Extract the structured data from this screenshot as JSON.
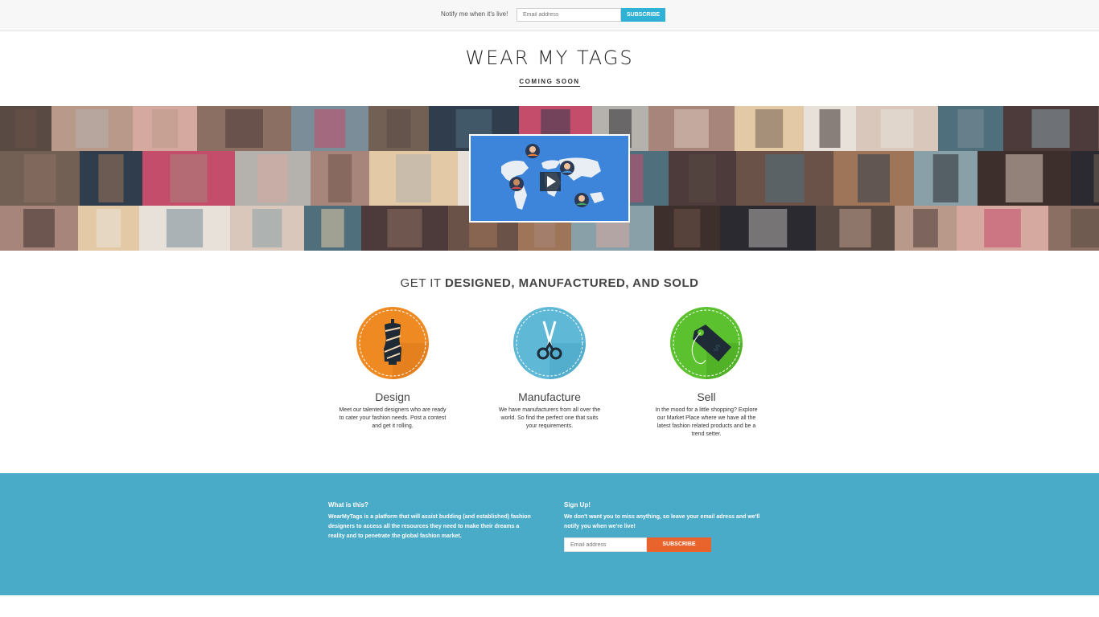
{
  "topbar": {
    "notify_text": "Notify me when it's live!",
    "email_placeholder": "Email address",
    "subscribe_label": "SUBSCRIBE"
  },
  "header": {
    "brand": "WEAR MY TAGS",
    "tagline": "COMING SOON"
  },
  "hero": {
    "video_icon": "play-icon"
  },
  "section": {
    "title_light": "GET IT ",
    "title_bold": "DESIGNED, MANUFACTURED, AND SOLD"
  },
  "features": [
    {
      "title": "Design",
      "icon": "mannequin-icon",
      "color": "#ef8a23",
      "desc": "Meet our talented designers who are ready to cater your fashion needs. Post a contest and get it rolling."
    },
    {
      "title": "Manufacture",
      "icon": "scissors-icon",
      "color": "#5fb9d6",
      "desc": "We have manufacturers from all over the world. So find the perfect one that suits your requirements."
    },
    {
      "title": "Sell",
      "icon": "price-tag-icon",
      "color": "#5cc12e",
      "desc": "In the mood for a little shopping? Explore our Market Place where we have all the latest fashion related products and be a trend setter."
    }
  ],
  "footer": {
    "about_heading": "What is this?",
    "about_text": "WearMyTags is a platform that will assist budding (and established) fashion designers to access all the resources they need to make their dreams a reality and to penetrate the global fashion market.",
    "signup_heading": "Sign Up!",
    "signup_text": "We don't want you to miss anything, so leave your email adress and we'll notify you when we're live!",
    "email_placeholder": "Email address",
    "subscribe_label": "SUBSCRIBE"
  },
  "colors": {
    "topbar_button": "#2fb2d6",
    "footer_bg": "#4aabc8",
    "footer_button": "#e8642c"
  }
}
